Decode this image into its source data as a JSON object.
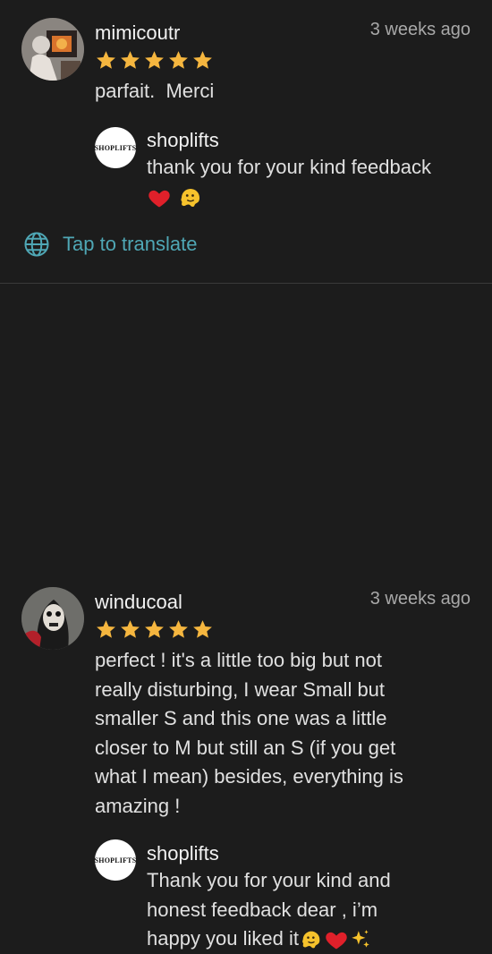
{
  "reviews": [
    {
      "username": "mimicoutr",
      "time": "3 weeks ago",
      "rating": 5,
      "text": "parfait.  Merci",
      "reply": {
        "author": "shoplifts",
        "avatar_label": "SHOPLIFTS",
        "text_line1": "thank you for your kind feedback"
      },
      "translate_label": "Tap to translate"
    },
    {
      "username": "winducoal",
      "time": "3 weeks ago",
      "rating": 5,
      "text_lines": [
        "perfect ! it's a little too big but not",
        "really disturbing, I wear Small but",
        "smaller S and this one was a little",
        "closer to M but still an S (if you get",
        "what I mean) besides, everything is",
        "amazing !"
      ],
      "reply": {
        "author": "shoplifts",
        "avatar_label": "SHOPLIFTS",
        "text_lines": [
          "Thank you for your kind and",
          "honest feedback dear , i’m",
          "happy you liked it"
        ]
      }
    }
  ],
  "colors": {
    "background": "#1c1c1c",
    "star": "#f5b63f",
    "link": "#4fa7b5",
    "heart": "#e0202a"
  },
  "icons": [
    "globe-icon",
    "star-icon",
    "heart-emoji",
    "melting-face-emoji",
    "sparkles-emoji"
  ]
}
